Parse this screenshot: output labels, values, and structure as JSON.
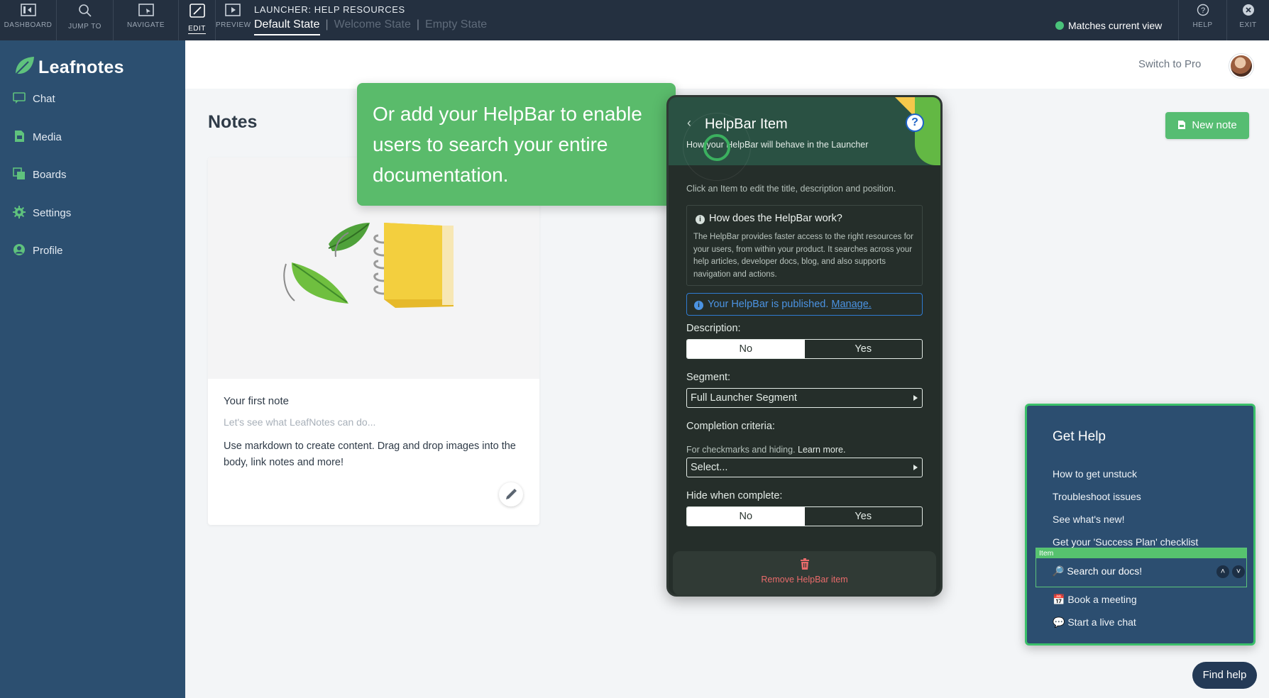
{
  "toolbar": {
    "tools": [
      {
        "label": "DASHBOARD",
        "icon": "dashboard-icon"
      },
      {
        "label": "JUMP TO",
        "icon": "search-icon"
      },
      {
        "label": "NAVIGATE",
        "icon": "navigate-icon"
      },
      {
        "label": "EDIT",
        "icon": "edit-icon",
        "active": true
      },
      {
        "label": "PREVIEW",
        "icon": "play-icon"
      }
    ],
    "launcher_title": "LAUNCHER: HELP RESOURCES",
    "states": [
      "Default State",
      "Welcome State",
      "Empty State"
    ],
    "active_state": "Default State",
    "match_status": "Matches current view",
    "help_label": "HELP",
    "exit_label": "EXIT"
  },
  "sidebar": {
    "app_name": "Leafnotes",
    "items": [
      {
        "label": "Chat",
        "icon": "chat-icon"
      },
      {
        "label": "Media",
        "icon": "media-icon"
      },
      {
        "label": "Boards",
        "icon": "boards-icon"
      },
      {
        "label": "Settings",
        "icon": "gear-icon"
      },
      {
        "label": "Profile",
        "icon": "profile-icon"
      }
    ]
  },
  "header": {
    "switch_label": "Switch to Pro"
  },
  "main": {
    "title": "Notes",
    "new_note_label": "New note",
    "note": {
      "title": "Your first note",
      "subtitle": "Let's see what LeafNotes can do...",
      "body": "Use markdown to create content. Drag and drop images into the body, link notes and more!"
    }
  },
  "tooltip": {
    "text": "Or add your HelpBar to enable users to search your entire documentation."
  },
  "panel": {
    "title": "HelpBar Item",
    "subtitle": "How your HelpBar will behave in the Launcher",
    "hint": "Click an Item to edit the title, description and position.",
    "how_title": "How does the HelpBar work?",
    "how_text": "The HelpBar provides faster access to the right resources for your users, from within your product. It searches across your help articles, developer docs, blog, and also supports navigation and actions.",
    "published_text": "Your HelpBar is published.",
    "manage_label": "Manage.",
    "description_label": "Description:",
    "description_options": [
      "No",
      "Yes"
    ],
    "description_value": "No",
    "segment_label": "Segment:",
    "segment_value": "Full Launcher Segment",
    "completion_label": "Completion criteria:",
    "completion_hint": "For checkmarks and hiding.",
    "learn_more": "Learn more.",
    "completion_placeholder": "Select...",
    "hide_label": "Hide when complete:",
    "hide_options": [
      "No",
      "Yes"
    ],
    "hide_value": "No",
    "remove_label": "Remove HelpBar item",
    "accent": "#5abb6b"
  },
  "launcher": {
    "title": "Get Help",
    "items": [
      "How to get unstuck",
      "Troubleshoot issues",
      "See what's new!",
      "Get your 'Success Plan' checklist"
    ],
    "item_tag": "Item",
    "highlighted_item": "🔎 Search our docs!",
    "after_items": [
      "📅 Book a meeting",
      "💬 Start a live chat"
    ],
    "find_help_label": "Find help"
  }
}
